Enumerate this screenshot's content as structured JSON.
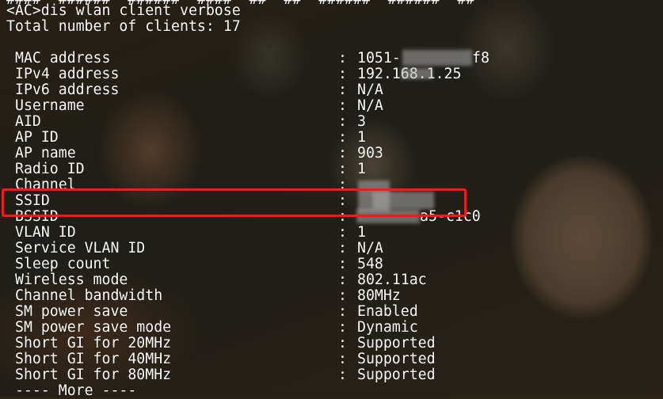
{
  "terminal": {
    "top_clip": "####  ######  ######  ####  ##  ##  ######  ######  ##",
    "command": "<AC>dis wlan client verbose",
    "total": "Total number of clients: 17",
    "separator": ":",
    "rows": [
      {
        "key": "MAC address",
        "value": "1051-"
      },
      {
        "key": "IPv4 address",
        "value": "192.168.1.25"
      },
      {
        "key": "IPv6 address",
        "value": "N/A"
      },
      {
        "key": "Username",
        "value": "N/A"
      },
      {
        "key": "AID",
        "value": "3"
      },
      {
        "key": "AP ID",
        "value": "1"
      },
      {
        "key": "AP name",
        "value": "903"
      },
      {
        "key": "Radio ID",
        "value": "1"
      },
      {
        "key": "Channel",
        "value": ""
      },
      {
        "key": "SSID",
        "value": ""
      },
      {
        "key": "BSSID",
        "value": "a5-c1c0"
      },
      {
        "key": "VLAN ID",
        "value": "1"
      },
      {
        "key": "Service VLAN ID",
        "value": "N/A"
      },
      {
        "key": "Sleep count",
        "value": "548"
      },
      {
        "key": "Wireless mode",
        "value": "802.11ac"
      },
      {
        "key": "Channel bandwidth",
        "value": "80MHz"
      },
      {
        "key": "SM power save",
        "value": "Enabled"
      },
      {
        "key": "SM power save mode",
        "value": "Dynamic"
      },
      {
        "key": "Short GI for 20MHz",
        "value": "Supported"
      },
      {
        "key": "Short GI for 40MHz",
        "value": "Supported"
      },
      {
        "key": "Short GI for 80MHz",
        "value": "Supported"
      }
    ],
    "mac_suffix": "f8",
    "more": "---- More ----"
  },
  "colors": {
    "text": "#ffffff",
    "highlight_border": "#e8201c"
  }
}
